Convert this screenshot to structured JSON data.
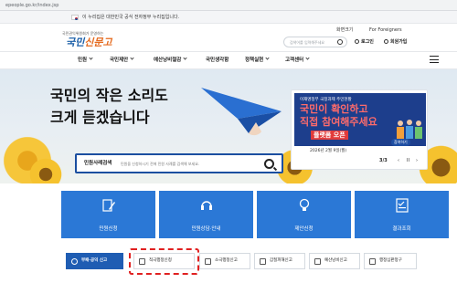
{
  "browser": {
    "url": "epeople.go.kr/index.jsp"
  },
  "notice": {
    "text": "이 누리집은 대한민국 공식 전자정부 누리집입니다."
  },
  "header": {
    "logo_small": "국민권익위원회가 운영하는",
    "logo_main_a": "국민",
    "logo_main_b": "신문고",
    "language": "화면크기",
    "foreign": "For Foreigners",
    "search_placeholder": "검색어를 입력해주세요",
    "login": "로그인",
    "signup": "회원가입"
  },
  "nav": {
    "items": [
      "민원",
      "국민제안",
      "예산낭비철감",
      "국민생각함",
      "정책실현",
      "고객센터"
    ]
  },
  "hero": {
    "headline_1": "국민의 작은 소리도",
    "headline_2": "크게 듣겠습니다",
    "search_label": "민원사례검색",
    "search_placeholder": "민원을 신청하시기 전에 민원 사례를 검색해 보세요."
  },
  "promo": {
    "line1": "이재명정부 국정과제 주민현황",
    "line2": "국민이 확인하고",
    "line3": "직접 참여해주세요",
    "line4": "플랫폼 오픈",
    "date": "2026년 2월 9일(월)",
    "more": "참여하기",
    "pager": "3/3",
    "prev": "‹",
    "pause": "II",
    "next": "›"
  },
  "tiles": [
    {
      "label": "민원신청",
      "icon": "pen-icon"
    },
    {
      "label": "민원상담·안내",
      "icon": "headset-icon"
    },
    {
      "label": "제안신청",
      "icon": "lightbulb-icon"
    },
    {
      "label": "결과조회",
      "icon": "checklist-icon"
    }
  ],
  "bottom_tabs": [
    {
      "label": "부패·공익 신고",
      "active": true
    },
    {
      "label": "적극행정신청",
      "active": false
    },
    {
      "label": "소극행정신고",
      "active": false
    },
    {
      "label": "갑질피해신고",
      "active": false
    },
    {
      "label": "예산낭비신고",
      "active": false
    },
    {
      "label": "행정심판청구",
      "active": false
    }
  ],
  "colors": {
    "primary": "#2b78d6",
    "brand": "#1f5db3",
    "highlight": "#e02020"
  }
}
